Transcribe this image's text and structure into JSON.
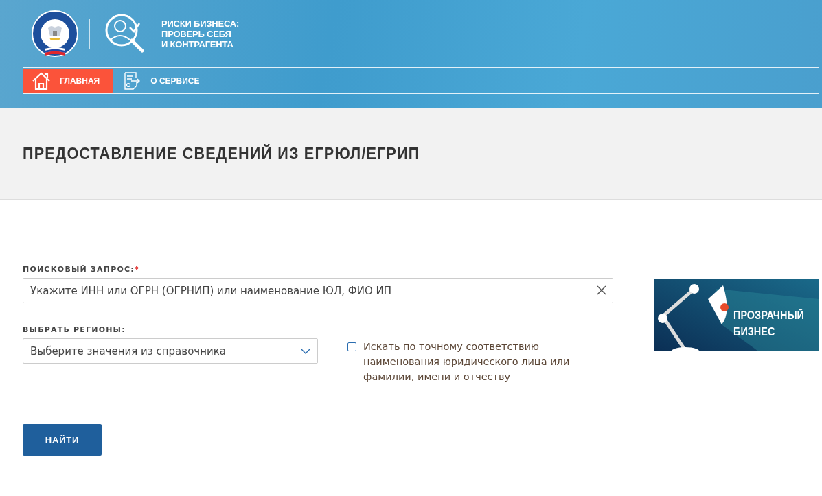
{
  "header": {
    "service_title": [
      "РИСКИ БИЗНЕСА:",
      "ПРОВЕРЬ СЕБЯ",
      "И КОНТРАГЕНТА"
    ]
  },
  "nav": [
    {
      "label": "ГЛАВНАЯ",
      "kind": "home",
      "selected": true
    },
    {
      "label": "О СЕРВИСЕ",
      "kind": "document",
      "selected": false
    }
  ],
  "page_title": "ПРЕДОСТАВЛЕНИЕ СВЕДЕНИЙ ИЗ ЕГРЮЛ/ЕГРИП",
  "form": {
    "query": {
      "label": "ПОИСКОВЫЙ ЗАПРОС:",
      "required_mark": "*",
      "placeholder": "Укажите ИНН или ОГРН (ОГРНИП) или наименование ЮЛ, ФИО ИП"
    },
    "regions": {
      "label": "ВЫБРАТЬ РЕГИОНЫ:",
      "placeholder": "Выберите значения из справочника"
    },
    "exact_match": {
      "label": "Искать по точному соответствию наименования юридического лица или фамилии, имени и отчеству",
      "checked": false
    },
    "submit": "НАЙТИ"
  },
  "banner": {
    "text": [
      "ПРОЗРАЧНЫЙ",
      "БИЗНЕС"
    ]
  }
}
